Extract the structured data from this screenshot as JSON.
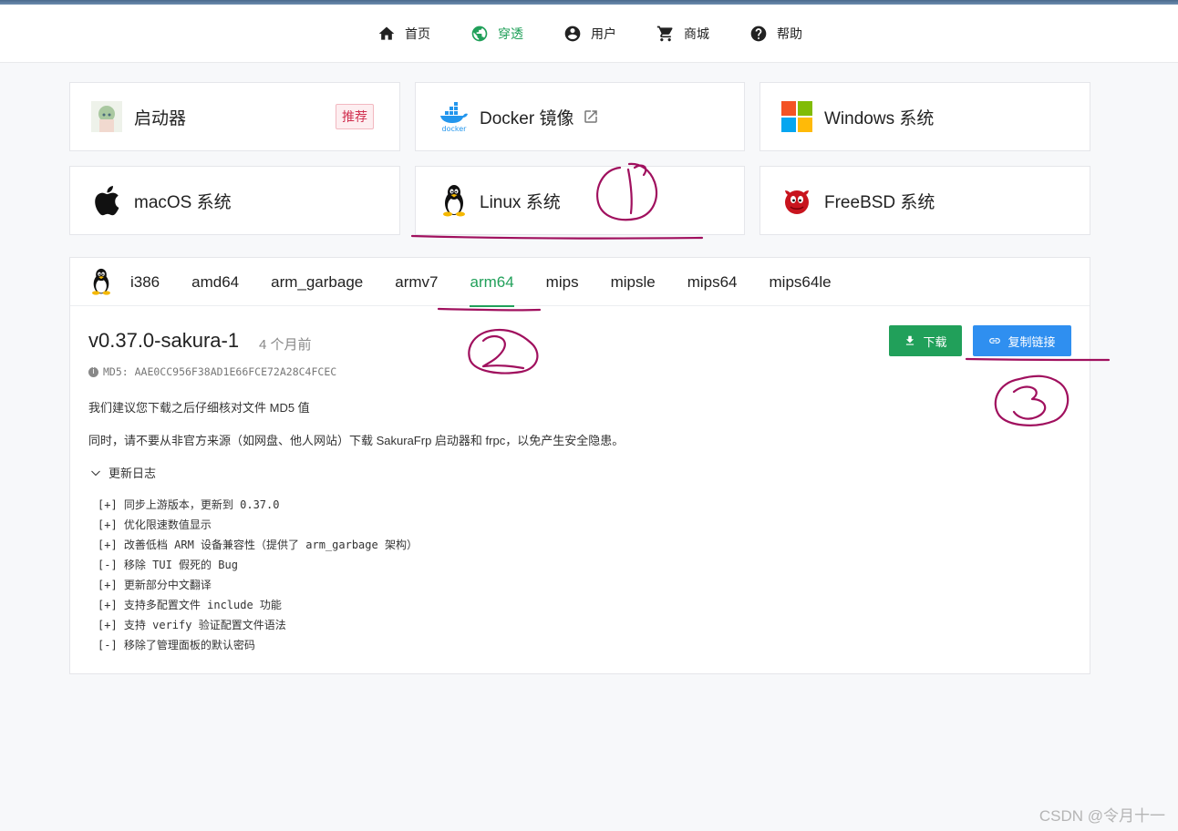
{
  "nav": {
    "items": [
      {
        "label": "首页",
        "icon": "home-icon"
      },
      {
        "label": "穿透",
        "icon": "globe-icon",
        "active": true
      },
      {
        "label": "用户",
        "icon": "user-circle-icon"
      },
      {
        "label": "商城",
        "icon": "cart-icon"
      },
      {
        "label": "帮助",
        "icon": "help-icon"
      }
    ]
  },
  "cards": [
    {
      "label": "启动器",
      "icon": "launcher-avatar-icon",
      "badge": "推荐"
    },
    {
      "label": "Docker 镜像",
      "icon": "docker-icon"
    },
    {
      "label": "Windows 系统",
      "icon": "windows-icon"
    },
    {
      "label": "macOS 系统",
      "icon": "apple-icon"
    },
    {
      "label": "Linux 系统",
      "icon": "tux-icon"
    },
    {
      "label": "FreeBSD 系统",
      "icon": "freebsd-icon"
    }
  ],
  "arch_tabs": [
    "i386",
    "amd64",
    "arm_garbage",
    "armv7",
    "arm64",
    "mips",
    "mipsle",
    "mips64",
    "mips64le"
  ],
  "active_tab": "arm64",
  "release": {
    "version": "v0.37.0-sakura-1",
    "age": "4 个月前",
    "md5": "MD5: AAE0CC956F38AD1E66FCE72A28C4FCEC",
    "download_label": "下载",
    "copy_link_label": "复制链接"
  },
  "notes": [
    "我们建议您下载之后仔细核对文件 MD5 值",
    "同时，请不要从非官方来源（如网盘、他人网站）下载 SakuraFrp 启动器和 frpc，以免产生安全隐患。"
  ],
  "changelog": {
    "toggle_label": "更新日志",
    "items": [
      "[+] 同步上游版本，更新到 0.37.0",
      "[+] 优化限速数值显示",
      "[+] 改善低档 ARM 设备兼容性（提供了 arm_garbage 架构）",
      "[-] 移除 TUI 假死的 Bug",
      "[+] 更新部分中文翻译",
      "[+] 支持多配置文件 include 功能",
      "[+] 支持 verify 验证配置文件语法",
      "[-] 移除了管理面板的默认密码"
    ]
  },
  "annotation_color": "#a0105e",
  "watermark": "CSDN @令月十一"
}
